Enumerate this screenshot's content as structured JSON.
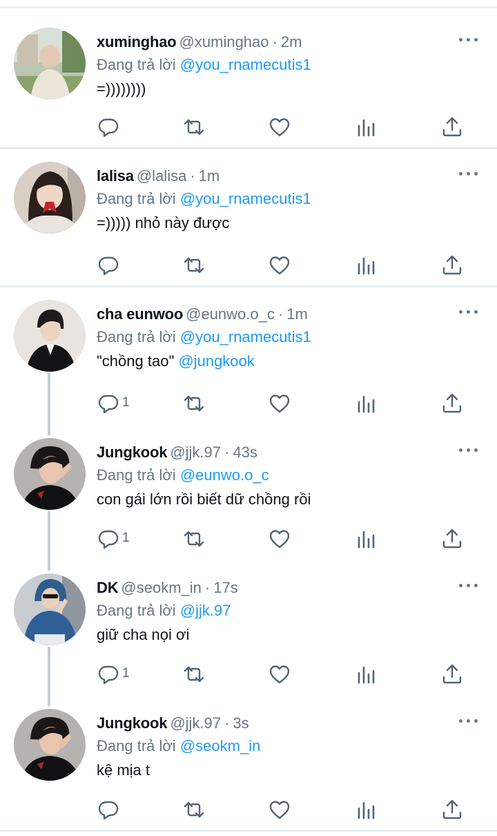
{
  "icons": {
    "reply": "speech-bubble-icon",
    "retweet": "retweet-arrows-icon",
    "like": "heart-icon",
    "views": "bar-chart-icon",
    "share": "share-upload-icon",
    "more": "three-dots-icon"
  },
  "colors": {
    "mention": "#1d9bf0",
    "secondary": "#687684",
    "separator": "#e6ecf0",
    "thread_line": "#c4cfd6"
  },
  "tweets": [
    {
      "name": "xuminghao",
      "handle": "@xuminghao",
      "time": "2m",
      "reply_prefix": "Đang trả lời",
      "reply_to": "@you_rnamecutis1",
      "text": "=))))))))",
      "text_mention": "",
      "reply_count": ""
    },
    {
      "name": "lalisa",
      "handle": "@lalisa",
      "time": "1m",
      "reply_prefix": "Đang trả lời",
      "reply_to": "@you_rnamecutis1",
      "text": "=))))) nhỏ này được",
      "text_mention": "",
      "reply_count": ""
    },
    {
      "name": "cha eunwoo",
      "handle": "@eunwo.o_c",
      "time": "1m",
      "reply_prefix": "Đang trả lời",
      "reply_to": "@you_rnamecutis1",
      "text": "\"chồng tao\" ",
      "text_mention": "@jungkook",
      "reply_count": "1"
    },
    {
      "name": "Jungkook",
      "handle": "@jjk.97",
      "time": "43s",
      "reply_prefix": "Đang trả lời",
      "reply_to": "@eunwo.o_c",
      "text": "con gái lớn rồi biết dữ chồng rồi",
      "text_mention": "",
      "reply_count": "1"
    },
    {
      "name": "DK",
      "handle": "@seokm_in",
      "time": "17s",
      "reply_prefix": "Đang trả lời",
      "reply_to": "@jjk.97",
      "text": "giữ cha nọi ơi",
      "text_mention": "",
      "reply_count": "1"
    },
    {
      "name": "Jungkook",
      "handle": "@jjk.97",
      "time": "3s",
      "reply_prefix": "Đang trả lời",
      "reply_to": "@seokm_in",
      "text": "kệ mịa t",
      "text_mention": "",
      "reply_count": ""
    }
  ]
}
